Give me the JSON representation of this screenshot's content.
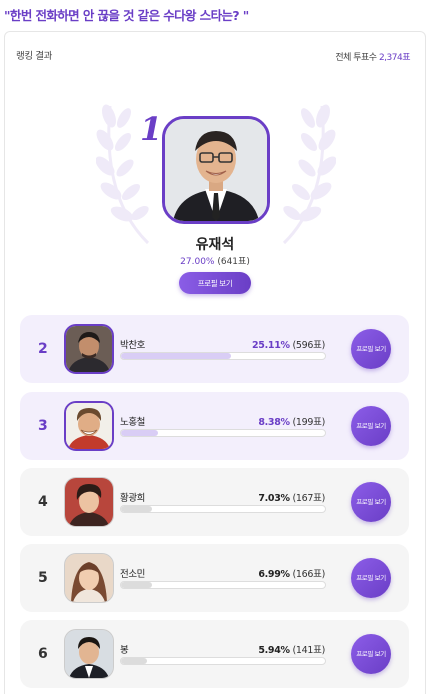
{
  "headline": "\"한번 전화하면 안 끊을 것 같은 수다왕 스타는? \"",
  "ranking_label": "랭킹 결과",
  "total_label": "전체 투표수 ",
  "total_count": "2,374표",
  "winner": {
    "rank": "1",
    "name": "유재석",
    "percent": "27.00%",
    "votes": " (641표)",
    "profile_button": "프로필 보기"
  },
  "ranks": [
    {
      "rank": "2",
      "name": "박찬호",
      "percent": "25.11%",
      "votes": " (596표)",
      "button": "프로필 보기",
      "fill": 0.2511
    },
    {
      "rank": "3",
      "name": "노홍철",
      "percent": "8.38%",
      "votes": " (199표)",
      "button": "프로필 보기",
      "fill": 0.0838
    },
    {
      "rank": "4",
      "name": "황광희",
      "percent": "7.03%",
      "votes": " (167표)",
      "button": "프로필 보기",
      "fill": 0.0703
    },
    {
      "rank": "5",
      "name": "전소민",
      "percent": "6.99%",
      "votes": " (166표)",
      "button": "프로필 보기",
      "fill": 0.0699
    },
    {
      "rank": "6",
      "name": "봉",
      "percent": "5.94%",
      "votes": " (141표)",
      "button": "프로필 보기",
      "fill": 0.0594
    }
  ],
  "colors": {
    "accent": "#6a3ec6",
    "highlight_bg": "#f3effc",
    "normal_bg": "#f5f5f5"
  }
}
